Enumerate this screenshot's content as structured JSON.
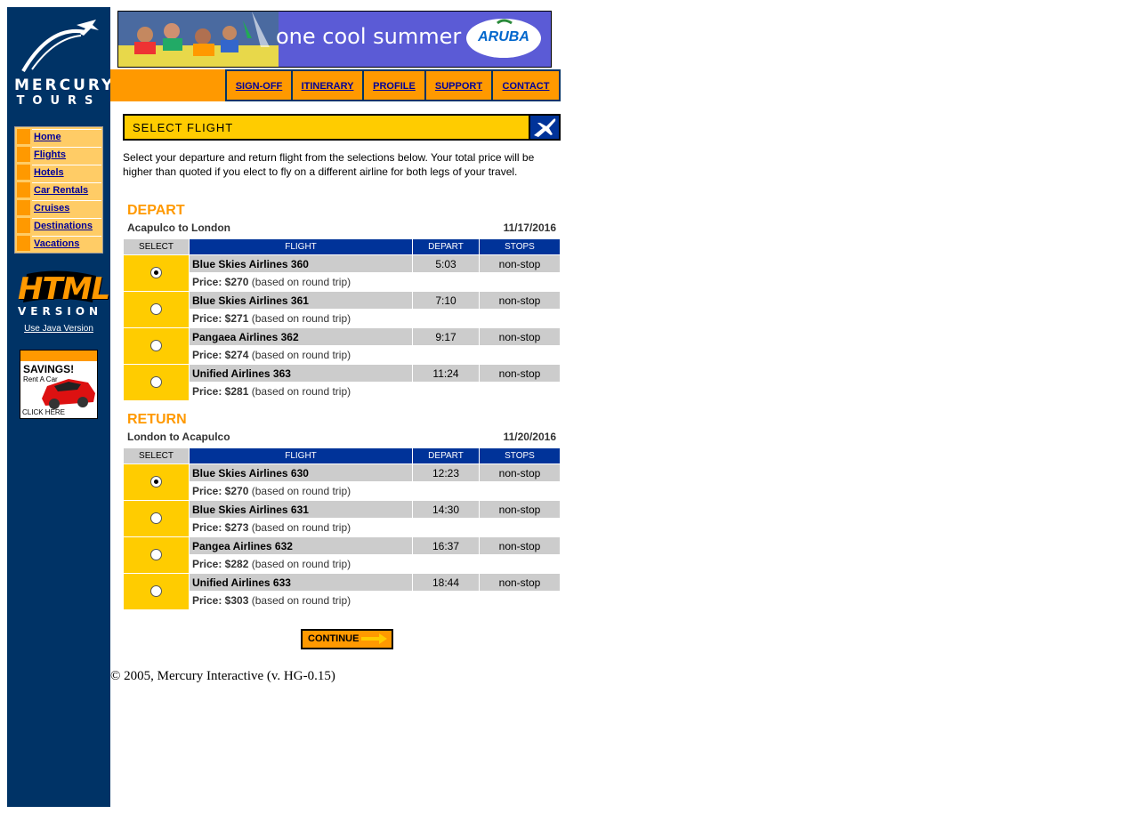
{
  "sidebar": {
    "logo_line1": "MERCURY",
    "logo_line2": "TOURS",
    "nav": [
      "Home",
      "Flights",
      "Hotels",
      "Car Rentals",
      "Cruises",
      "Destinations",
      "Vacations"
    ],
    "html_version_line1": "HTML",
    "html_version_line2": "VERSION",
    "java_link": "Use Java Version",
    "ad": {
      "title": "SAVINGS!",
      "subtitle": "Rent A Car",
      "cta": "CLICK HERE"
    }
  },
  "banner": {
    "text": "one cool summer",
    "brand": "ARUBA"
  },
  "topnav": [
    "SIGN-OFF",
    "ITINERARY",
    "PROFILE",
    "SUPPORT",
    "CONTACT"
  ],
  "page_title": "SELECT FLIGHT",
  "intro": "Select your departure and return flight from the selections below. Your total price will be higher than quoted if you elect to fly on a different airline for both legs of your travel.",
  "table_headers": {
    "select": "SELECT",
    "flight": "FLIGHT",
    "depart": "DEPART",
    "stops": "STOPS"
  },
  "depart": {
    "title": "DEPART",
    "route": "Acapulco to London",
    "date": "11/17/2016",
    "flights": [
      {
        "name": "Blue Skies Airlines 360",
        "time": "5:03",
        "stops": "non-stop",
        "price_label": "Price: $270",
        "note": "(based on round trip)",
        "selected": true
      },
      {
        "name": "Blue Skies Airlines 361",
        "time": "7:10",
        "stops": "non-stop",
        "price_label": "Price: $271",
        "note": "(based on round trip)",
        "selected": false
      },
      {
        "name": "Pangaea Airlines 362",
        "time": "9:17",
        "stops": "non-stop",
        "price_label": "Price: $274",
        "note": "(based on round trip)",
        "selected": false
      },
      {
        "name": "Unified Airlines 363",
        "time": "11:24",
        "stops": "non-stop",
        "price_label": "Price: $281",
        "note": "(based on round trip)",
        "selected": false
      }
    ]
  },
  "return": {
    "title": "RETURN",
    "route": "London to Acapulco",
    "date": "11/20/2016",
    "flights": [
      {
        "name": "Blue Skies Airlines 630",
        "time": "12:23",
        "stops": "non-stop",
        "price_label": "Price: $270",
        "note": "(based on round trip)",
        "selected": true
      },
      {
        "name": "Blue Skies Airlines 631",
        "time": "14:30",
        "stops": "non-stop",
        "price_label": "Price: $273",
        "note": "(based on round trip)",
        "selected": false
      },
      {
        "name": "Pangea Airlines 632",
        "time": "16:37",
        "stops": "non-stop",
        "price_label": "Price: $282",
        "note": "(based on round trip)",
        "selected": false
      },
      {
        "name": "Unified Airlines 633",
        "time": "18:44",
        "stops": "non-stop",
        "price_label": "Price: $303",
        "note": "(based on round trip)",
        "selected": false
      }
    ]
  },
  "continue_label": "CONTINUE",
  "footer": "© 2005, Mercury Interactive (v. HG-0.15)",
  "colors": {
    "navy": "#003366",
    "orange": "#ff9900",
    "gold": "#ffcc00",
    "blue": "#003399",
    "link": "#000099"
  }
}
